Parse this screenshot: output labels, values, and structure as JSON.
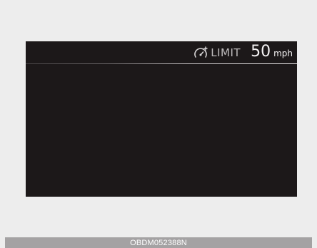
{
  "display": {
    "limit_label": "LIMIT",
    "limit_value": "50",
    "limit_unit": "mph",
    "icon": "speed-limit-gauge-icon"
  },
  "caption": {
    "code": "OBDM052388N"
  },
  "colors": {
    "page_background": "#ededed",
    "display_background": "#1c1819",
    "text": "#f4f2f3",
    "caption_bar": "#a4a2a3"
  }
}
